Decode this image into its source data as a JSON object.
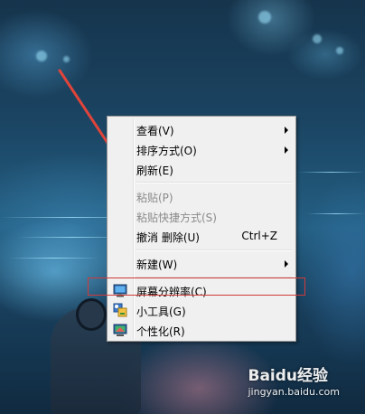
{
  "context_menu": {
    "items": [
      {
        "label": "查看(V)",
        "has_submenu": true,
        "enabled": true
      },
      {
        "label": "排序方式(O)",
        "has_submenu": true,
        "enabled": true
      },
      {
        "label": "刷新(E)",
        "has_submenu": false,
        "enabled": true
      },
      {
        "label": "粘贴(P)",
        "has_submenu": false,
        "enabled": false
      },
      {
        "label": "粘贴快捷方式(S)",
        "has_submenu": false,
        "enabled": false
      },
      {
        "label": "撤消 删除(U)",
        "shortcut": "Ctrl+Z",
        "has_submenu": false,
        "enabled": true
      },
      {
        "label": "新建(W)",
        "has_submenu": true,
        "enabled": true
      },
      {
        "label": "屏幕分辨率(C)",
        "icon": "display-icon",
        "has_submenu": false,
        "enabled": true,
        "highlighted": true
      },
      {
        "label": "小工具(G)",
        "icon": "gadgets-icon",
        "has_submenu": false,
        "enabled": true
      },
      {
        "label": "个性化(R)",
        "icon": "personalize-icon",
        "has_submenu": false,
        "enabled": true
      }
    ]
  },
  "annotation": {
    "arrow_color": "#e0443a",
    "box_color": "#d23a3a"
  },
  "watermark": {
    "logo": "Baidu经验",
    "url": "jingyan.baidu.com"
  }
}
